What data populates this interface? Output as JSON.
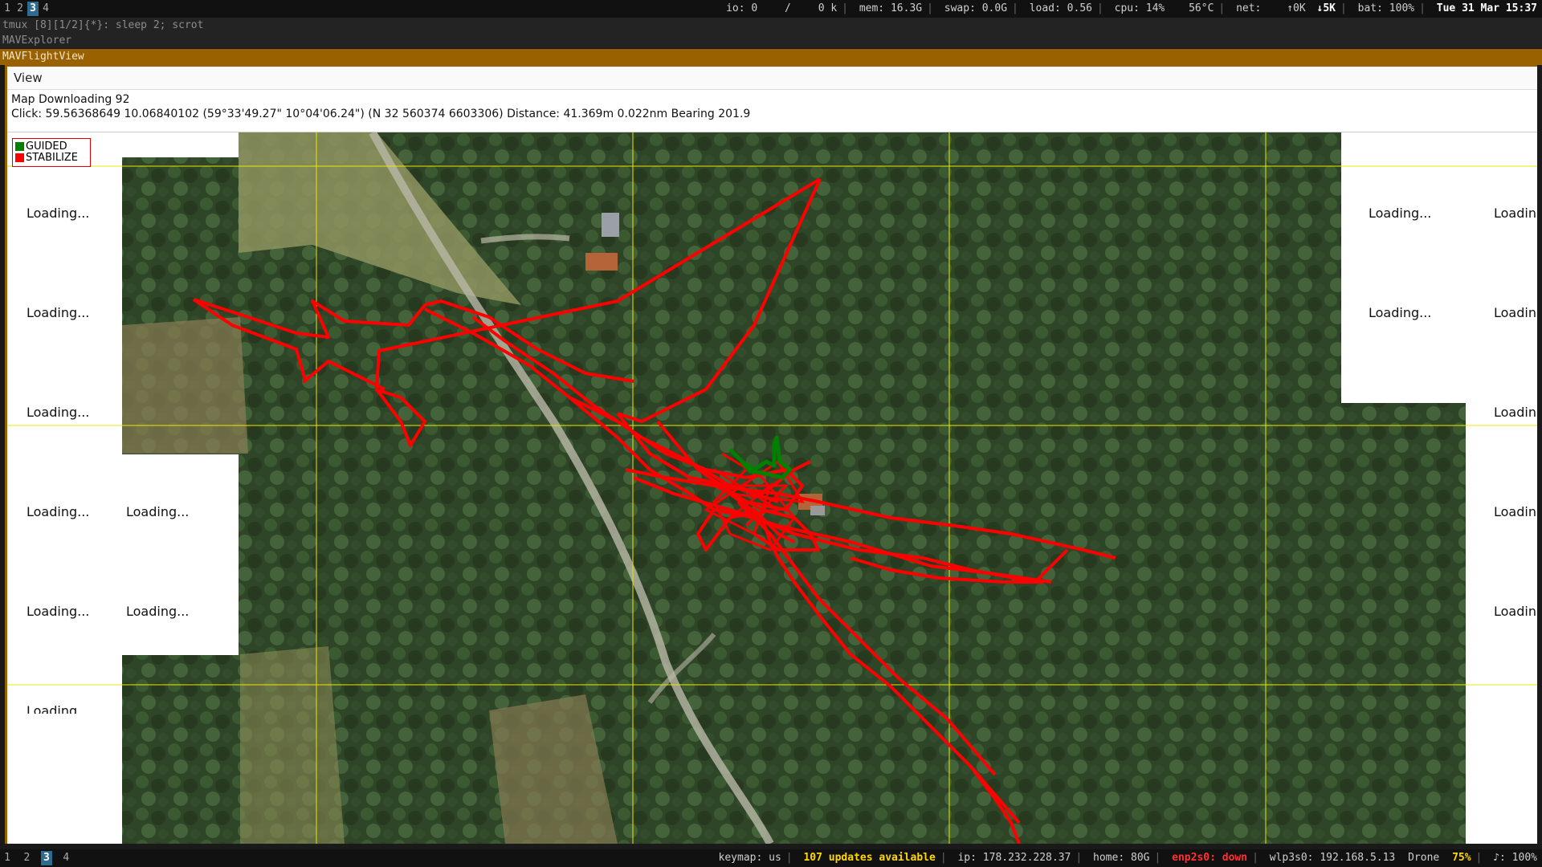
{
  "workspaces": [
    "1",
    "2",
    "3",
    "4"
  ],
  "active_workspace": "3",
  "top_status": {
    "io": "io: 0",
    "io_sep": "/",
    "io_k": "0 k",
    "mem": "mem: 16.3G",
    "swap": "swap: 0.0G",
    "load": "load: 0.56",
    "cpu": "cpu:  14%",
    "temp": "56°C",
    "net": "net:",
    "up": "↑0K",
    "down": "↓5K",
    "bat": "bat: 100%",
    "datetime": "Tue 31 Mar 15:37"
  },
  "tmux_line": "tmux [8][1/2]{*}:  sleep 2; scrot",
  "explorer_title": "MAVExplorer",
  "window_title": "MAVFlightView",
  "menu": {
    "view": "View"
  },
  "info": {
    "line1": "Map Downloading 92",
    "line2": "Click: 59.56368649 10.06840102 (59°33'49.27\" 10°04'06.24\") (N 32 560374 6603306)  Distance: 41.369m 0.022nm Bearing 201.9"
  },
  "legend": [
    {
      "label": "GUIDED",
      "color": "#008000"
    },
    {
      "label": "STABILIZE",
      "color": "#ff0000"
    }
  ],
  "loading_text": "Loading...",
  "loading_partial": "Loadin",
  "loading_cut": "Loading",
  "colors": {
    "track_stabilize": "#ff0000",
    "track_guided": "#008000",
    "grid": "#e8e800"
  },
  "bottom_status": {
    "keymap": "keymap: us",
    "updates": "107 updates available",
    "ip": "ip: 178.232.228.37",
    "home": "home: 80G",
    "eth": "enp2s0: down",
    "wlan": "wlp3s0: 192.168.5.13",
    "drone": "Drone",
    "drone_pct": "75%",
    "volume": "♪: 100%"
  }
}
